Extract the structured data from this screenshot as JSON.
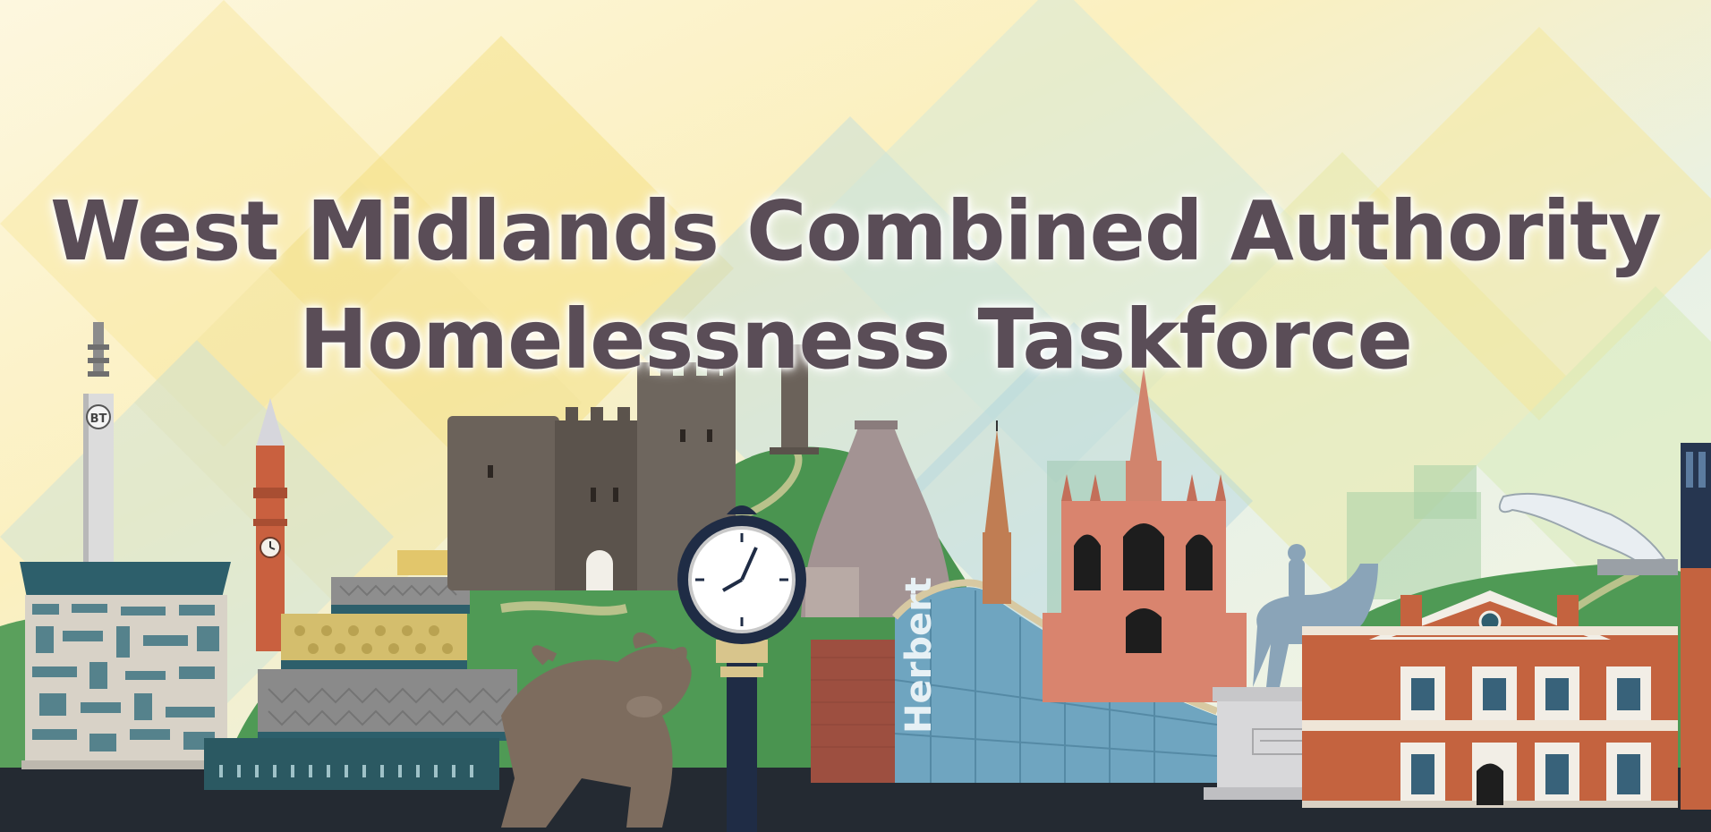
{
  "banner": {
    "title_line1": "West Midlands Combined Authority",
    "title_line2": "Homelessness Taskforce",
    "bt_tower_badge": "BT",
    "gallery_sign": "Herbert"
  },
  "colors": {
    "title": "#5a4d57",
    "ground": "#242a32",
    "hills": "#4f9a55",
    "sky_yellow": "#f5de7a",
    "sky_blue": "#a9d3de"
  },
  "icons": [
    "bt-tower-icon",
    "clock-tower-icon",
    "castle-icon",
    "bull-statue-icon",
    "street-clock-icon",
    "cathedral-icon",
    "horse-statue-icon",
    "jaguar-sculpture-icon"
  ]
}
